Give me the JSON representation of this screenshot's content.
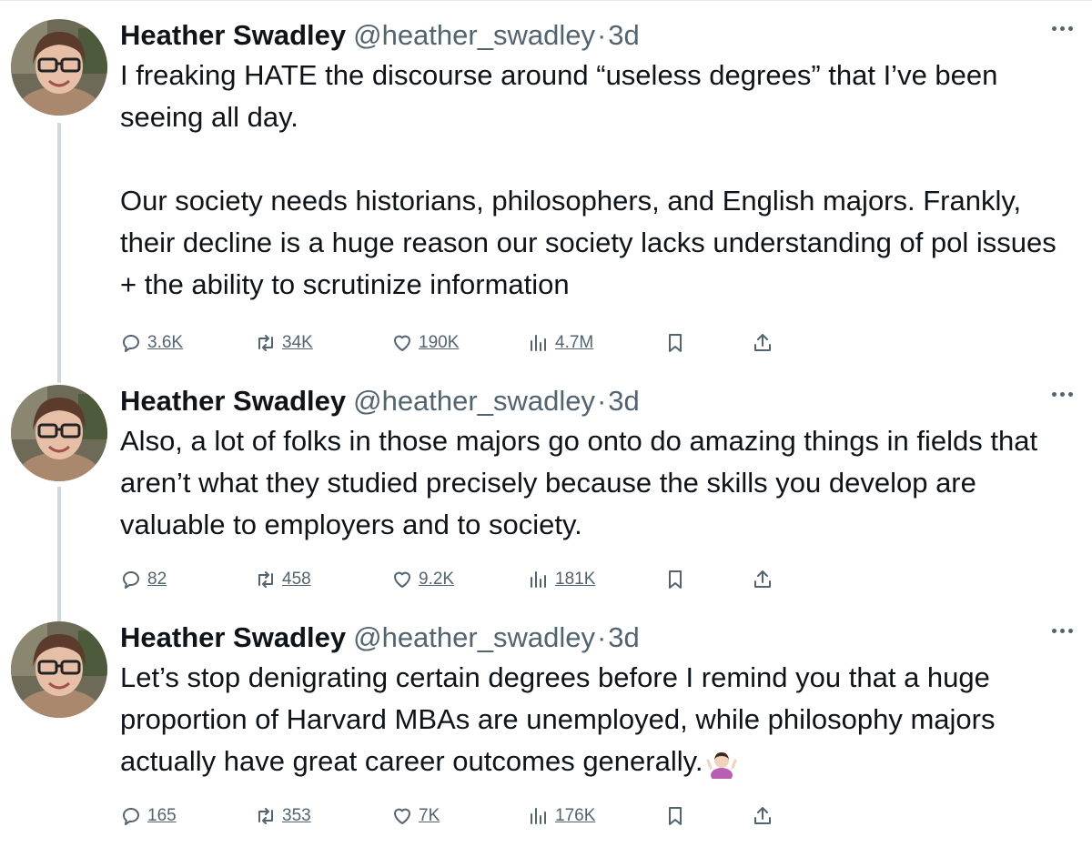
{
  "tweets": [
    {
      "name": "Heather Swadley",
      "handle": "@heather_swadley",
      "separator": "·",
      "time": "3d",
      "text": "I freaking HATE the discourse around “useless degrees” that I’ve been seeing all day.\n\nOur society needs historians, philosophers, and English majors. Frankly, their decline is a huge reason our society lacks understanding of pol issues + the ability to scrutinize information",
      "replies": "3.6K",
      "retweets": "34K",
      "likes": "190K",
      "views": "4.7M"
    },
    {
      "name": "Heather Swadley",
      "handle": "@heather_swadley",
      "separator": "·",
      "time": "3d",
      "text": "Also, a lot of folks in those majors go onto do amazing things in fields that aren’t what they studied precisely because the skills you develop are valuable to employers and to society.",
      "replies": "82",
      "retweets": "458",
      "likes": "9.2K",
      "views": "181K"
    },
    {
      "name": "Heather Swadley",
      "handle": "@heather_swadley",
      "separator": "·",
      "time": "3d",
      "text": "Let’s stop denigrating certain degrees before I remind you that a huge proportion of Harvard MBAs are unemployed, while philosophy majors actually have great career outcomes generally.",
      "emoji": "person-shrugging-emoji",
      "replies": "165",
      "retweets": "353",
      "likes": "7K",
      "views": "176K"
    }
  ],
  "icons": {
    "reply": "reply-icon",
    "retweet": "retweet-icon",
    "like": "heart-icon",
    "views": "views-icon",
    "bookmark": "bookmark-icon",
    "share": "share-icon",
    "more": "more-icon"
  },
  "colors": {
    "text": "#0f1419",
    "secondary": "#536471",
    "thread_line": "#cfd9de"
  }
}
